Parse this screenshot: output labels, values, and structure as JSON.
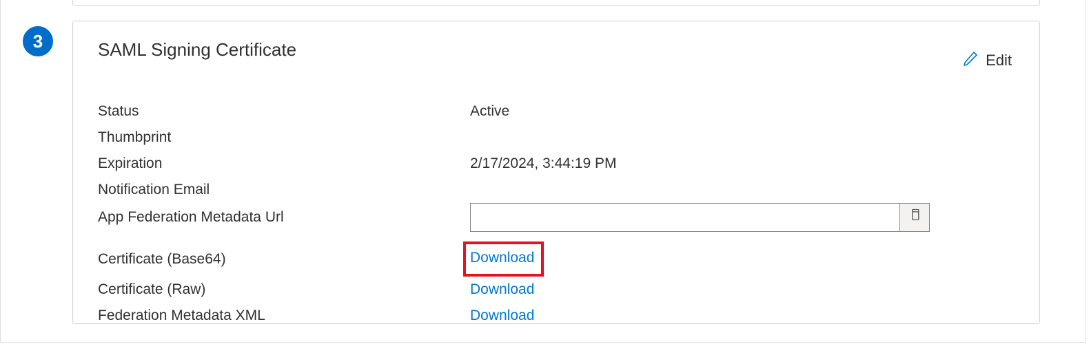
{
  "step_number": "3",
  "card": {
    "title": "SAML Signing Certificate",
    "edit_label": "Edit"
  },
  "fields": {
    "status_label": "Status",
    "status_value": "Active",
    "thumbprint_label": "Thumbprint",
    "thumbprint_value": "",
    "expiration_label": "Expiration",
    "expiration_value": "2/17/2024, 3:44:19 PM",
    "notification_email_label": "Notification Email",
    "notification_email_value": "",
    "metadata_url_label": "App Federation Metadata Url",
    "metadata_url_value": "",
    "cert_base64_label": "Certificate (Base64)",
    "cert_base64_link": "Download",
    "cert_raw_label": "Certificate (Raw)",
    "cert_raw_link": "Download",
    "fed_xml_label": "Federation Metadata XML",
    "fed_xml_link": "Download"
  }
}
